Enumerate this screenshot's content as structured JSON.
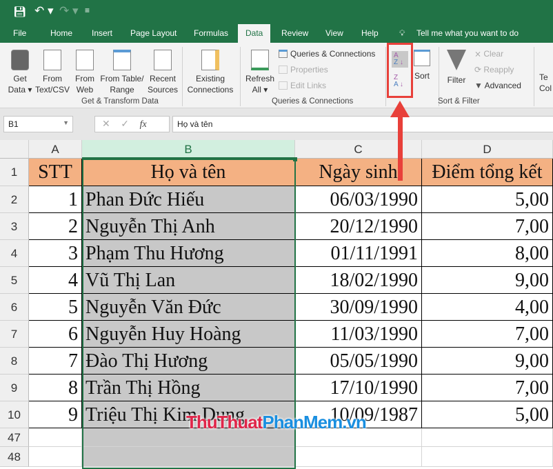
{
  "qat": {
    "save": "save-icon",
    "undo": "undo-icon",
    "redo": "redo-icon",
    "customize": "customize-icon"
  },
  "tabs": [
    "File",
    "Home",
    "Insert",
    "Page Layout",
    "Formulas",
    "Data",
    "Review",
    "View",
    "Help"
  ],
  "tell_me": "Tell me what you want to do",
  "ribbon": {
    "get_data": [
      "Get",
      "Data ▾"
    ],
    "from_text": [
      "From",
      "Text/CSV"
    ],
    "from_web": [
      "From",
      "Web"
    ],
    "from_table": [
      "From Table/",
      "Range"
    ],
    "recent": [
      "Recent",
      "Sources"
    ],
    "existing": [
      "Existing",
      "Connections"
    ],
    "group1": "Get & Transform Data",
    "refresh": [
      "Refresh",
      "All ▾"
    ],
    "queries": "Queries & Connections",
    "properties": "Properties",
    "edit_links": "Edit Links",
    "group2": "Queries & Connections",
    "sort": "Sort",
    "filter": "Filter",
    "clear": "Clear",
    "reapply": "Reapply",
    "advanced": "Advanced",
    "group3": "Sort & Filter",
    "text_cols": [
      "Te",
      "Col"
    ]
  },
  "name_box": "B1",
  "formula": "Họ và tên",
  "columns": [
    "A",
    "B",
    "C",
    "D"
  ],
  "rows": [
    {
      "n": "1",
      "cells": [
        "STT",
        "Họ và tên",
        "Ngày sinh",
        "Điểm tổng kết"
      ]
    },
    {
      "n": "2",
      "cells": [
        "1",
        "Phan Đức Hiếu",
        "06/03/1990",
        "5,00"
      ]
    },
    {
      "n": "3",
      "cells": [
        "2",
        "Nguyễn Thị Anh",
        "20/12/1990",
        "7,00"
      ]
    },
    {
      "n": "4",
      "cells": [
        "3",
        "Phạm Thu Hương",
        "01/11/1991",
        "8,00"
      ]
    },
    {
      "n": "5",
      "cells": [
        "4",
        "Vũ Thị Lan",
        "18/02/1990",
        "9,00"
      ]
    },
    {
      "n": "6",
      "cells": [
        "5",
        "Nguyễn Văn Đức",
        "30/09/1990",
        "4,00"
      ]
    },
    {
      "n": "7",
      "cells": [
        "6",
        "Nguyễn Huy Hoàng",
        "11/03/1990",
        "7,00"
      ]
    },
    {
      "n": "8",
      "cells": [
        "7",
        "Đào Thị Hương",
        "05/05/1990",
        "9,00"
      ]
    },
    {
      "n": "9",
      "cells": [
        "8",
        "Trần Thị Hồng",
        "17/10/1990",
        "7,00"
      ]
    },
    {
      "n": "10",
      "cells": [
        "9",
        "Triệu Thị Kim Dung",
        "10/09/1987",
        "5,00"
      ]
    }
  ],
  "empty_rows": [
    "47",
    "48"
  ],
  "watermark": {
    "part1": "ThuThuat",
    "part2": "PhanMem.vn"
  },
  "colors": {
    "excel_green": "#217346",
    "header_fill": "#f4b183",
    "selection": "#c8c8c8",
    "highlight": "#e8403a"
  }
}
